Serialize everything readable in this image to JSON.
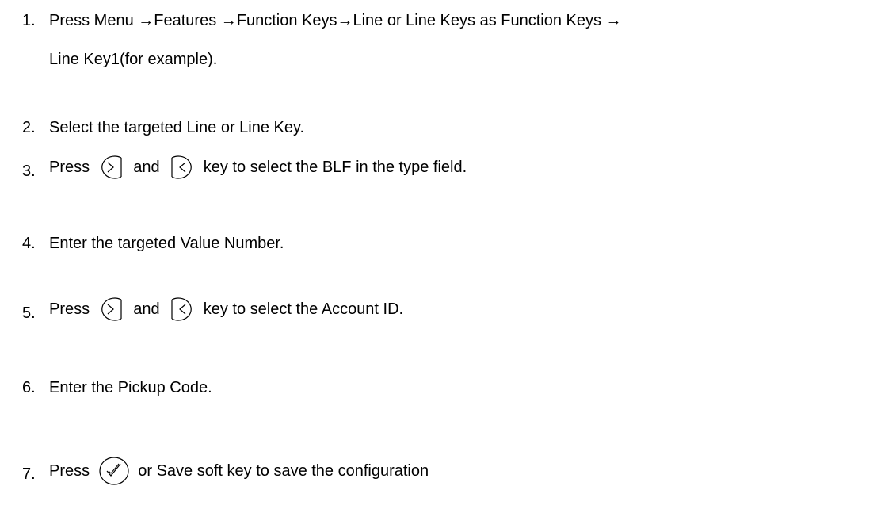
{
  "steps": [
    {
      "number": "1.",
      "text": "Press Menu →Features →Function Keys→Line or Line Keys as Function Keys →",
      "text2": "Line Key1(for example)."
    },
    {
      "number": "2.",
      "text": "Select the targeted Line or Line Key."
    },
    {
      "number": "3.",
      "before": "Press",
      "middle": "and",
      "after": "key to select the BLF in the type field."
    },
    {
      "number": "4.",
      "text": "Enter the targeted Value Number."
    },
    {
      "number": "5.",
      "before": "Press",
      "middle": "and",
      "after": "key to select the Account ID."
    },
    {
      "number": "6.",
      "text": "Enter the Pickup Code."
    },
    {
      "number": "7.",
      "before": "Press",
      "after": "or Save soft key to save the configuration"
    }
  ],
  "icons": {
    "right_key": "right-arrow-key-icon",
    "left_key": "left-arrow-key-icon",
    "ok_key": "ok-check-key-icon"
  }
}
